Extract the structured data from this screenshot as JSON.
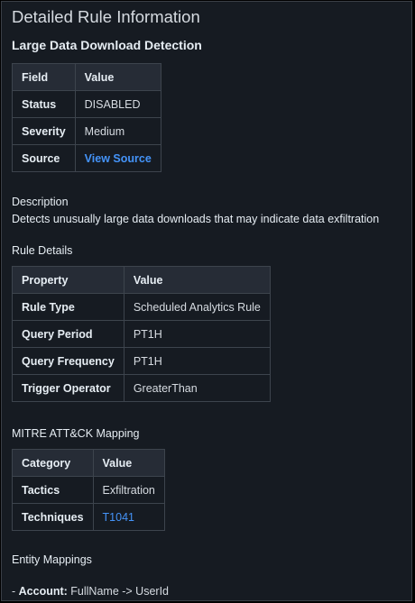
{
  "page": {
    "title": "Detailed Rule Information",
    "rule_name": "Large Data Download Detection"
  },
  "overview_table": {
    "headers": [
      "Field",
      "Value"
    ],
    "rows": [
      {
        "field": "Status",
        "value": "DISABLED"
      },
      {
        "field": "Severity",
        "value": "Medium"
      },
      {
        "field": "Source",
        "value": "View Source"
      }
    ]
  },
  "description": {
    "label": "Description",
    "text": "Detects unusually large data downloads that may indicate data exfiltration"
  },
  "rule_details": {
    "label": "Rule Details",
    "headers": [
      "Property",
      "Value"
    ],
    "rows": [
      {
        "property": "Rule Type",
        "value": "Scheduled Analytics Rule"
      },
      {
        "property": "Query Period",
        "value": "PT1H"
      },
      {
        "property": "Query Frequency",
        "value": "PT1H"
      },
      {
        "property": "Trigger Operator",
        "value": "GreaterThan"
      }
    ]
  },
  "mitre": {
    "label": "MITRE ATT&CK Mapping",
    "headers": [
      "Category",
      "Value"
    ],
    "rows": [
      {
        "category": "Tactics",
        "value": "Exfiltration"
      },
      {
        "category": "Techniques",
        "value": "T1041"
      }
    ]
  },
  "entity_mappings": {
    "label": "Entity Mappings",
    "items": [
      {
        "prefix": "- ",
        "entity": "Account:",
        "mapping": " FullName -> UserId"
      }
    ]
  },
  "colors": {
    "panel_bg": "#161b22",
    "table_header_bg": "#262c36",
    "border": "#3d444d",
    "link": "#4493f8",
    "text": "#e6edf3"
  }
}
